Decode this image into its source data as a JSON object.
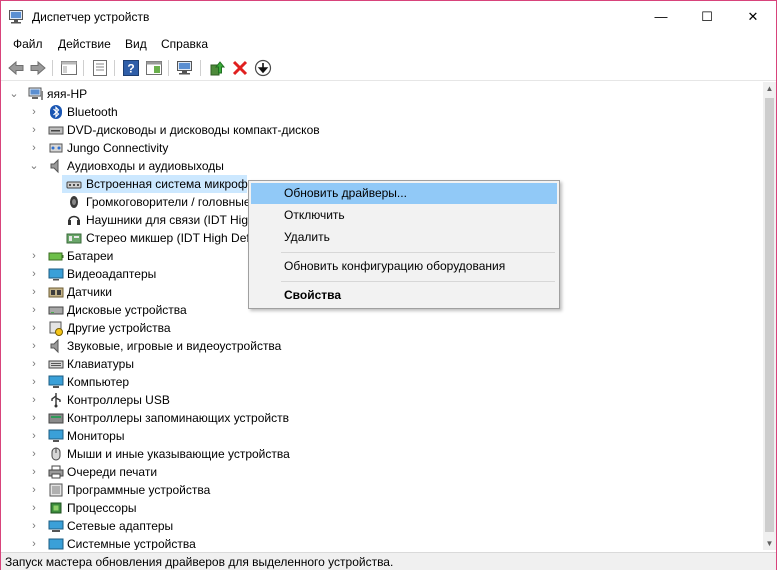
{
  "window": {
    "title": "Диспетчер устройств",
    "minimize": "—",
    "maximize": "☐",
    "close": "✕"
  },
  "menu": [
    "Файл",
    "Действие",
    "Вид",
    "Справка"
  ],
  "tree": {
    "root": "яяя-HP",
    "categories": [
      "Bluetooth",
      "DVD-дисководы и дисководы компакт-дисков",
      "Jungo Connectivity",
      "Аудиовходы и аудиовыходы",
      "Батареи",
      "Видеоадаптеры",
      "Датчики",
      "Дисковые устройства",
      "Другие устройства",
      "Звуковые, игровые и видеоустройства",
      "Клавиатуры",
      "Компьютер",
      "Контроллеры USB",
      "Контроллеры запоминающих устройств",
      "Мониторы",
      "Мыши и иные указывающие устройства",
      "Очереди печати",
      "Программные устройства",
      "Процессоры",
      "Сетевые адаптеры",
      "Системные устройства"
    ],
    "audio_children": [
      "Встроенная система микрофонов",
      "Громкоговорители / головные телефоны",
      "Наушники для связи (IDT High Definition Audio CODEC)",
      "Стерео микшер (IDT High Definition Audio CODEC)"
    ]
  },
  "context_menu": {
    "update": "Обновить драйверы...",
    "disable": "Отключить",
    "delete": "Удалить",
    "scan": "Обновить конфигурацию оборудования",
    "properties": "Свойства"
  },
  "status": "Запуск мастера обновления драйверов для выделенного устройства.",
  "colors": {
    "highlight": "#91c9f7",
    "selection": "#cce8ff",
    "window_border": "#d8437b"
  }
}
